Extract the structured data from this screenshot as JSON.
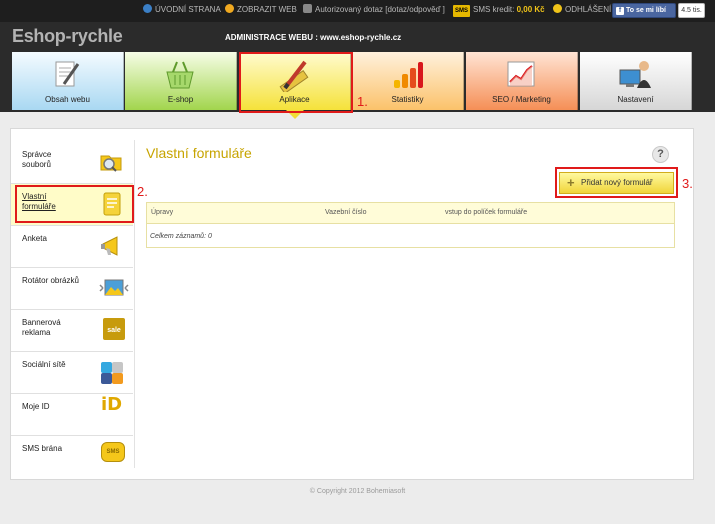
{
  "topbar": {
    "links": [
      {
        "label": "ÚVODNÍ STRANA",
        "icon": "info-icon"
      },
      {
        "label": "ZOBRAZIT WEB",
        "icon": "sun-icon"
      },
      {
        "label": "Autorizovaný dotaz [dotaz/odpověď ]",
        "icon": "chat-icon"
      }
    ],
    "sms_badge": "SMS",
    "sms_label": "SMS kredit:",
    "sms_value": "0,00 Kč",
    "logout": "ODHLÁŠENÍ",
    "like_button": "To se mi líbí",
    "like_count": "4.5 tis."
  },
  "header": {
    "logo": "Eshop-rychle",
    "admin_title": "ADMINISTRACE WEBU : www.eshop-rychle.cz"
  },
  "nav": {
    "tabs": [
      {
        "label": "Obsah webu",
        "icon": "document-edit-icon"
      },
      {
        "label": "E-shop",
        "icon": "basket-icon"
      },
      {
        "label": "Aplikace",
        "icon": "ruler-pencil-icon",
        "active": true
      },
      {
        "label": "Statistiky",
        "icon": "bar-chart-icon"
      },
      {
        "label": "SEO / Marketing",
        "icon": "line-chart-icon"
      },
      {
        "label": "Nastavení",
        "icon": "user-computer-icon"
      }
    ]
  },
  "annotations": [
    "1.",
    "2.",
    "3."
  ],
  "sidebar": {
    "items": [
      {
        "label": "Správce souborů",
        "icon": "folder-search-icon"
      },
      {
        "label": "Vlastní formuláře",
        "icon": "form-icon",
        "active": true
      },
      {
        "label": "Anketa",
        "icon": "megaphone-icon"
      },
      {
        "label": "Rotátor obrázků",
        "icon": "image-rotator-icon"
      },
      {
        "label": "Bannerová reklama",
        "icon": "sale-banner-icon"
      },
      {
        "label": "Sociální sítě",
        "icon": "social-icon"
      },
      {
        "label": "Moje ID",
        "icon": "mojeid-icon"
      },
      {
        "label": "SMS brána",
        "icon": "sms-icon"
      }
    ]
  },
  "main": {
    "title": "Vlastní formuláře",
    "help": "?",
    "add_button": "Přidat nový formulář",
    "table": {
      "headers": [
        "Úpravy",
        "Vazební číslo",
        "vstup do políček formuláře"
      ],
      "summary": "Celkem záznamů: 0"
    }
  },
  "footer": {
    "copyright": "© Copyright 2012 Bohemiasoft"
  },
  "colors": {
    "accent_yellow": "#f5e23a",
    "title_gold": "#c7a400",
    "annotation_red": "#e01a1a",
    "topbar_bg": "#1e1e1e"
  }
}
